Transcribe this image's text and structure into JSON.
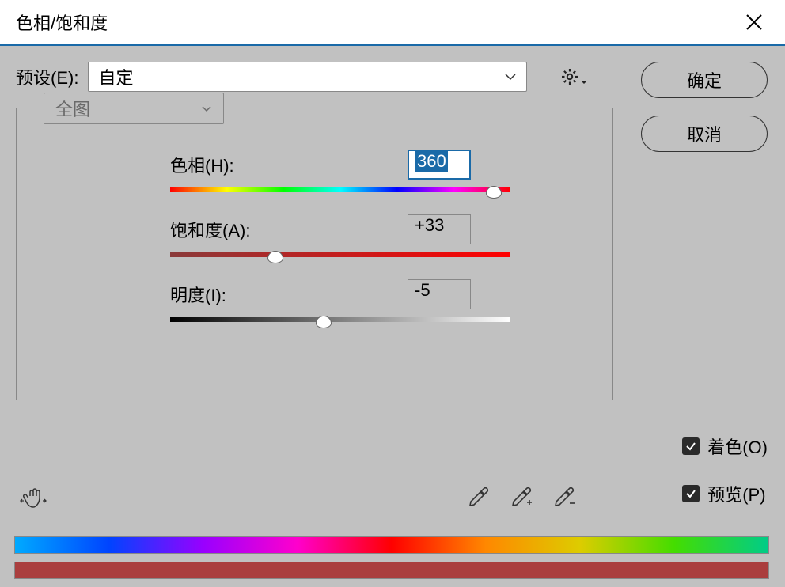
{
  "titlebar": {
    "title": "色相/饱和度"
  },
  "preset": {
    "label": "预设(E):",
    "value": "自定"
  },
  "buttons": {
    "ok": "确定",
    "cancel": "取消"
  },
  "scope": {
    "value": "全图"
  },
  "sliders": {
    "hue": {
      "label": "色相(H):",
      "value": "360",
      "position": 95
    },
    "saturation": {
      "label": "饱和度(A):",
      "value": "+33",
      "position": 31
    },
    "lightness": {
      "label": "明度(I):",
      "value": "-5",
      "position": 45
    }
  },
  "checkboxes": {
    "colorize": {
      "label": "着色(O)",
      "checked": true
    },
    "preview": {
      "label": "预览(P)",
      "checked": true
    }
  }
}
